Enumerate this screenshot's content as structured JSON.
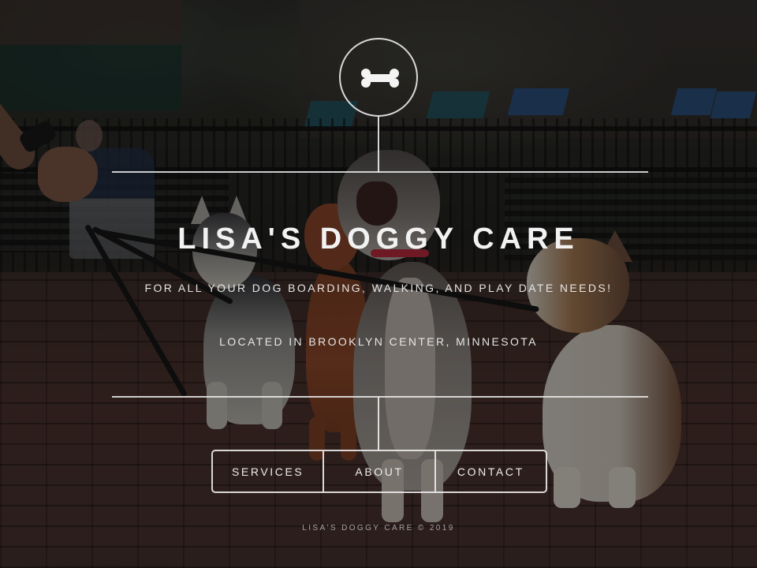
{
  "site": {
    "title": "LISA'S DOGGY CARE",
    "tagline": "FOR ALL YOUR DOG BOARDING, WALKING, AND PLAY DATE NEEDS!",
    "location": "LOCATED IN BROOKLYN CENTER, MINNESOTA",
    "logo_icon": "bone-icon"
  },
  "nav": {
    "items": [
      {
        "label": "SERVICES"
      },
      {
        "label": "ABOUT"
      },
      {
        "label": "CONTACT"
      }
    ]
  },
  "footer": {
    "copyright": "LISA'S DOGGY CARE © 2019"
  },
  "colors": {
    "line": "#ececec",
    "text": "#e8e8e8",
    "overlay": "rgba(8,8,8,0.42)"
  },
  "background": {
    "icon": "dogs-on-leash-photo"
  }
}
